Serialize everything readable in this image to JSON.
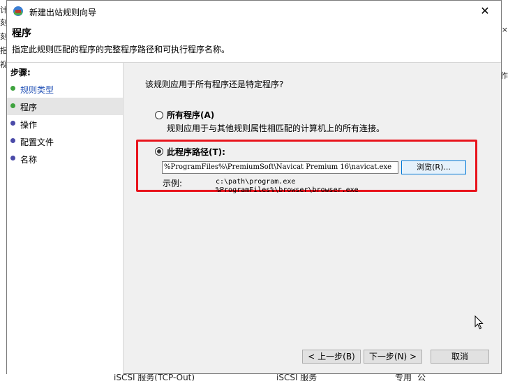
{
  "background": {
    "left_fragments": [
      "计",
      "刻",
      "刻",
      "指",
      "视"
    ],
    "right_fragments": [
      "×",
      "作"
    ],
    "bottom_row": [
      "iSCSI 服务(TCP-Out)",
      "iSCSI 服务",
      "专用",
      "公"
    ]
  },
  "window": {
    "title": "新建出站规则向导",
    "close_glyph": "✕"
  },
  "header": {
    "title": "程序",
    "description": "指定此规则匹配的程序的完整程序路径和可执行程序名称。"
  },
  "steps": {
    "title": "步骤:",
    "items": [
      {
        "label": "规则类型",
        "state": "done"
      },
      {
        "label": "程序",
        "state": "current"
      },
      {
        "label": "操作",
        "state": "pending"
      },
      {
        "label": "配置文件",
        "state": "pending"
      },
      {
        "label": "名称",
        "state": "pending"
      }
    ]
  },
  "main": {
    "question": "该规则应用于所有程序还是特定程序?",
    "option_all": {
      "label": "所有程序(A)",
      "description": "规则应用于与其他规则属性相匹配的计算机上的所有连接。",
      "selected": false
    },
    "option_path": {
      "label": "此程序路径(T):",
      "selected": true
    },
    "path_value": "%ProgramFiles%\\PremiumSoft\\Navicat Premium 16\\navicat.exe",
    "browse_label": "浏览(R)...",
    "example_label": "示例:",
    "example_line1": "c:\\path\\program.exe",
    "example_line2": "%ProgramFiles%\\browser\\browser.exe"
  },
  "footer": {
    "back_label": "< 上一步(B)",
    "next_label": "下一步(N) >",
    "cancel_label": "取消"
  },
  "colors": {
    "highlight_box": "#e8141c",
    "accent": "#0078d7"
  }
}
